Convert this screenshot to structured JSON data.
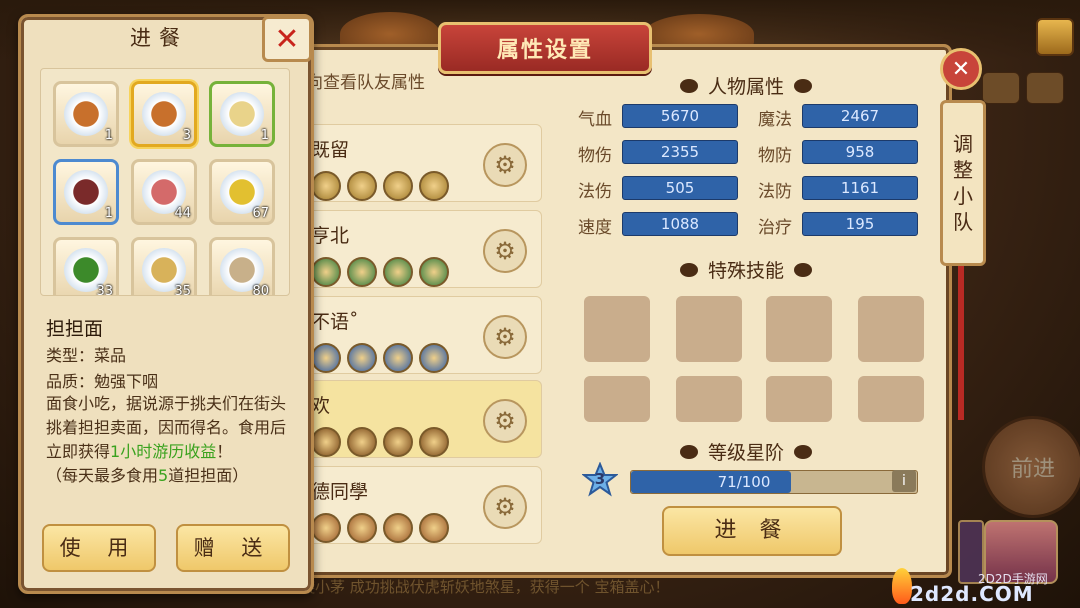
{
  "main_panel": {
    "title": "属性设置",
    "close_label": "✕",
    "teammate_hint": "向查看队友属性",
    "team_rows": [
      {
        "name": "既留",
        "dot_color": "#a07a2a"
      },
      {
        "name": "亨北",
        "dot_color": "#2e7a3a"
      },
      {
        "name": "不语˚",
        "dot_color": "#2a5aa8"
      },
      {
        "name": "欢",
        "dot_color": "#7a4a1a"
      },
      {
        "name": "德同學",
        "dot_color": "#9a5a2a"
      }
    ],
    "attr_section": {
      "heading": "人物属性",
      "stats": [
        {
          "label": "气血",
          "value": "5670"
        },
        {
          "label": "魔法",
          "value": "2467"
        },
        {
          "label": "物伤",
          "value": "2355"
        },
        {
          "label": "物防",
          "value": "958"
        },
        {
          "label": "法伤",
          "value": "505"
        },
        {
          "label": "法防",
          "value": "1161"
        },
        {
          "label": "速度",
          "value": "1088"
        },
        {
          "label": "治疗",
          "value": "195"
        }
      ]
    },
    "skills_section": {
      "heading": "特殊技能"
    },
    "level_section": {
      "heading": "等级星阶",
      "star_level": "3",
      "progress_text": "71/100",
      "progress_fraction": 0.71,
      "info_label": "i"
    },
    "eat_button": "进 餐",
    "adjust_team": [
      "调",
      "整",
      "小",
      "队"
    ],
    "forward_label": "前进"
  },
  "eat_panel": {
    "title": "进餐",
    "close_label": "✕",
    "items": [
      {
        "name": "dandan-noodles-1",
        "count": "1",
        "color": "#c8702c",
        "border": "default"
      },
      {
        "name": "dandan-noodles-3",
        "count": "3",
        "color": "#c8702c",
        "border": "gold"
      },
      {
        "name": "tofu-dish",
        "count": "1",
        "color": "#e9d38a",
        "border": "green"
      },
      {
        "name": "braised-meat",
        "count": "1",
        "color": "#7a2a2a",
        "border": "blue"
      },
      {
        "name": "raw-meat",
        "count": "44",
        "color": "#d46a6a",
        "border": "default"
      },
      {
        "name": "beans",
        "count": "67",
        "color": "#e2c030",
        "border": "default"
      },
      {
        "name": "greens",
        "count": "33",
        "color": "#3c8a2a",
        "border": "default"
      },
      {
        "name": "wheat",
        "count": "35",
        "color": "#d8b25a",
        "border": "default"
      },
      {
        "name": "shrimp",
        "count": "80",
        "color": "#c8b08a",
        "border": "default"
      }
    ],
    "selected_name": "担担面",
    "type_line": "类型：菜品",
    "quality_line": "品质：勉强下咽",
    "desc_part1": "面食小吃，据说源于挑夫们在街头挑着担担卖面，因而得名。食用后立即获得",
    "desc_green": "1小时游历收益",
    "desc_part2": "！",
    "limit_part1": "（每天最多食用",
    "limit_green": "5",
    "limit_part2": "道担担面）",
    "use_button": "使 用",
    "give_button": "赠 送"
  },
  "background": {
    "marquee": "璇小茅 成功挑战伏虎斩妖地煞星，获得一个 宝箱盖心！"
  },
  "watermark": {
    "small": "2D2D手游网",
    "big": "2d2d.COM"
  }
}
